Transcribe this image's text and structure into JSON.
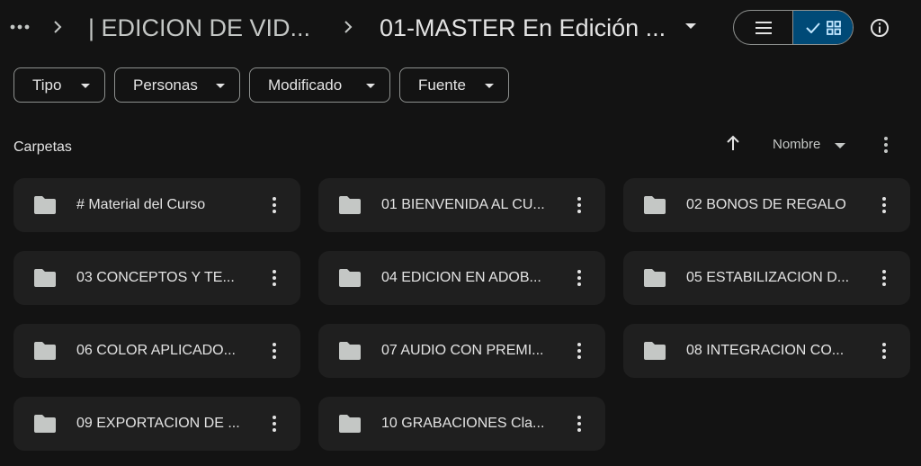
{
  "breadcrumb": {
    "more_icon": "more-horiz-icon",
    "items": [
      "| EDICION DE VID...",
      "01-MASTER En Edición ..."
    ]
  },
  "view_toggle": {
    "list_icon": "list-view-icon",
    "grid_icon": "grid-view-icon",
    "selected": "grid"
  },
  "accent_color": "#004a77",
  "filters": [
    "Tipo",
    "Personas",
    "Modificado",
    "Fuente"
  ],
  "section": {
    "title": "Carpetas",
    "sort_label": "Nombre",
    "sort_direction": "ascending"
  },
  "folders": [
    "# Material del Curso",
    "01 BIENVENIDA AL CU...",
    "02 BONOS DE REGALO",
    "03 CONCEPTOS Y TE...",
    "04 EDICION EN ADOB...",
    "05 ESTABILIZACION D...",
    "06 COLOR APLICADO...",
    "07 AUDIO CON PREMI...",
    "08 INTEGRACION CO...",
    "09 EXPORTACION DE ...",
    "10 GRABACIONES Cla..."
  ]
}
